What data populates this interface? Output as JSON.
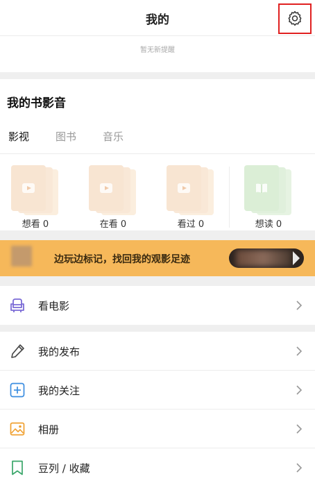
{
  "header": {
    "title": "我的",
    "settings_icon": "gear-icon"
  },
  "notice": {
    "text": "暂无新提醒"
  },
  "library": {
    "title": "我的书影音",
    "tabs": [
      {
        "label": "影视",
        "active": true
      },
      {
        "label": "图书",
        "active": false
      },
      {
        "label": "音乐",
        "active": false
      }
    ],
    "items": [
      {
        "label": "想看 0",
        "icon": "play-icon",
        "color": "#f8e5d2"
      },
      {
        "label": "在看 0",
        "icon": "play-icon",
        "color": "#f8e5d2"
      },
      {
        "label": "看过 0",
        "icon": "play-icon",
        "color": "#f8e5d2"
      },
      {
        "label": "想读 0",
        "icon": "book-icon",
        "color": "#dbeed6"
      }
    ]
  },
  "banner": {
    "text": "边玩边标记，找回我的观影足迹",
    "color": "#f6b85a"
  },
  "menu": {
    "movie": {
      "label": "看电影",
      "icon": "seat-icon",
      "color": "#7b6bd6"
    },
    "items": [
      {
        "label": "我的发布",
        "icon": "pen-icon",
        "color": "#444444"
      },
      {
        "label": "我的关注",
        "icon": "plus-box-icon",
        "color": "#3b8de0"
      },
      {
        "label": "相册",
        "icon": "photo-icon",
        "color": "#f0a030"
      },
      {
        "label": "豆列 / 收藏",
        "icon": "bookmark-icon",
        "color": "#3aa66a"
      }
    ]
  }
}
